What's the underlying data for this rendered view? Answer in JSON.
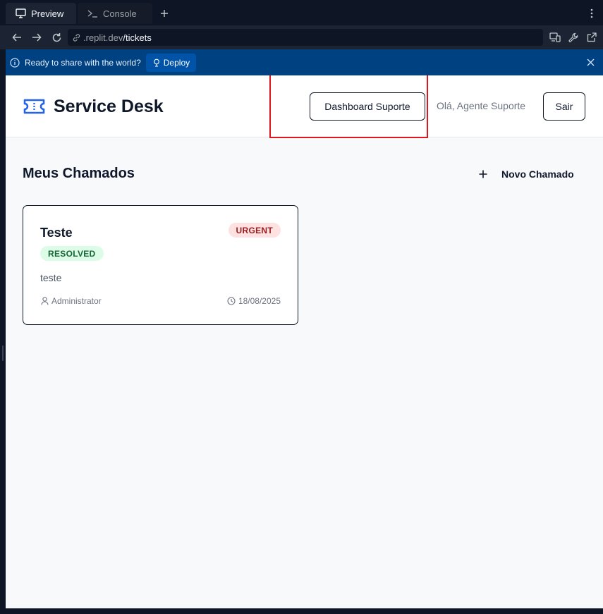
{
  "browser": {
    "tabs": [
      {
        "label": "Preview",
        "icon": "monitor-icon",
        "active": true
      },
      {
        "label": "Console",
        "icon": "terminal-icon",
        "active": false
      }
    ],
    "url": {
      "domain": ".replit.dev",
      "path": "/tickets"
    }
  },
  "deploy_banner": {
    "message": "Ready to share with the world?",
    "button_label": "Deploy"
  },
  "header": {
    "app_title": "Service Desk",
    "dashboard_button": "Dashboard Suporte",
    "greeting": "Olá, Agente Suporte",
    "logout_button": "Sair"
  },
  "main": {
    "section_title": "Meus Chamados",
    "new_ticket_button": "Novo Chamado",
    "tickets": [
      {
        "title": "Teste",
        "priority": "URGENT",
        "status": "RESOLVED",
        "description": "teste",
        "author": "Administrator",
        "date": "18/08/2025"
      }
    ]
  },
  "colors": {
    "accent": "#2563eb",
    "highlight_box": "#e0161e",
    "banner": "#004182"
  }
}
